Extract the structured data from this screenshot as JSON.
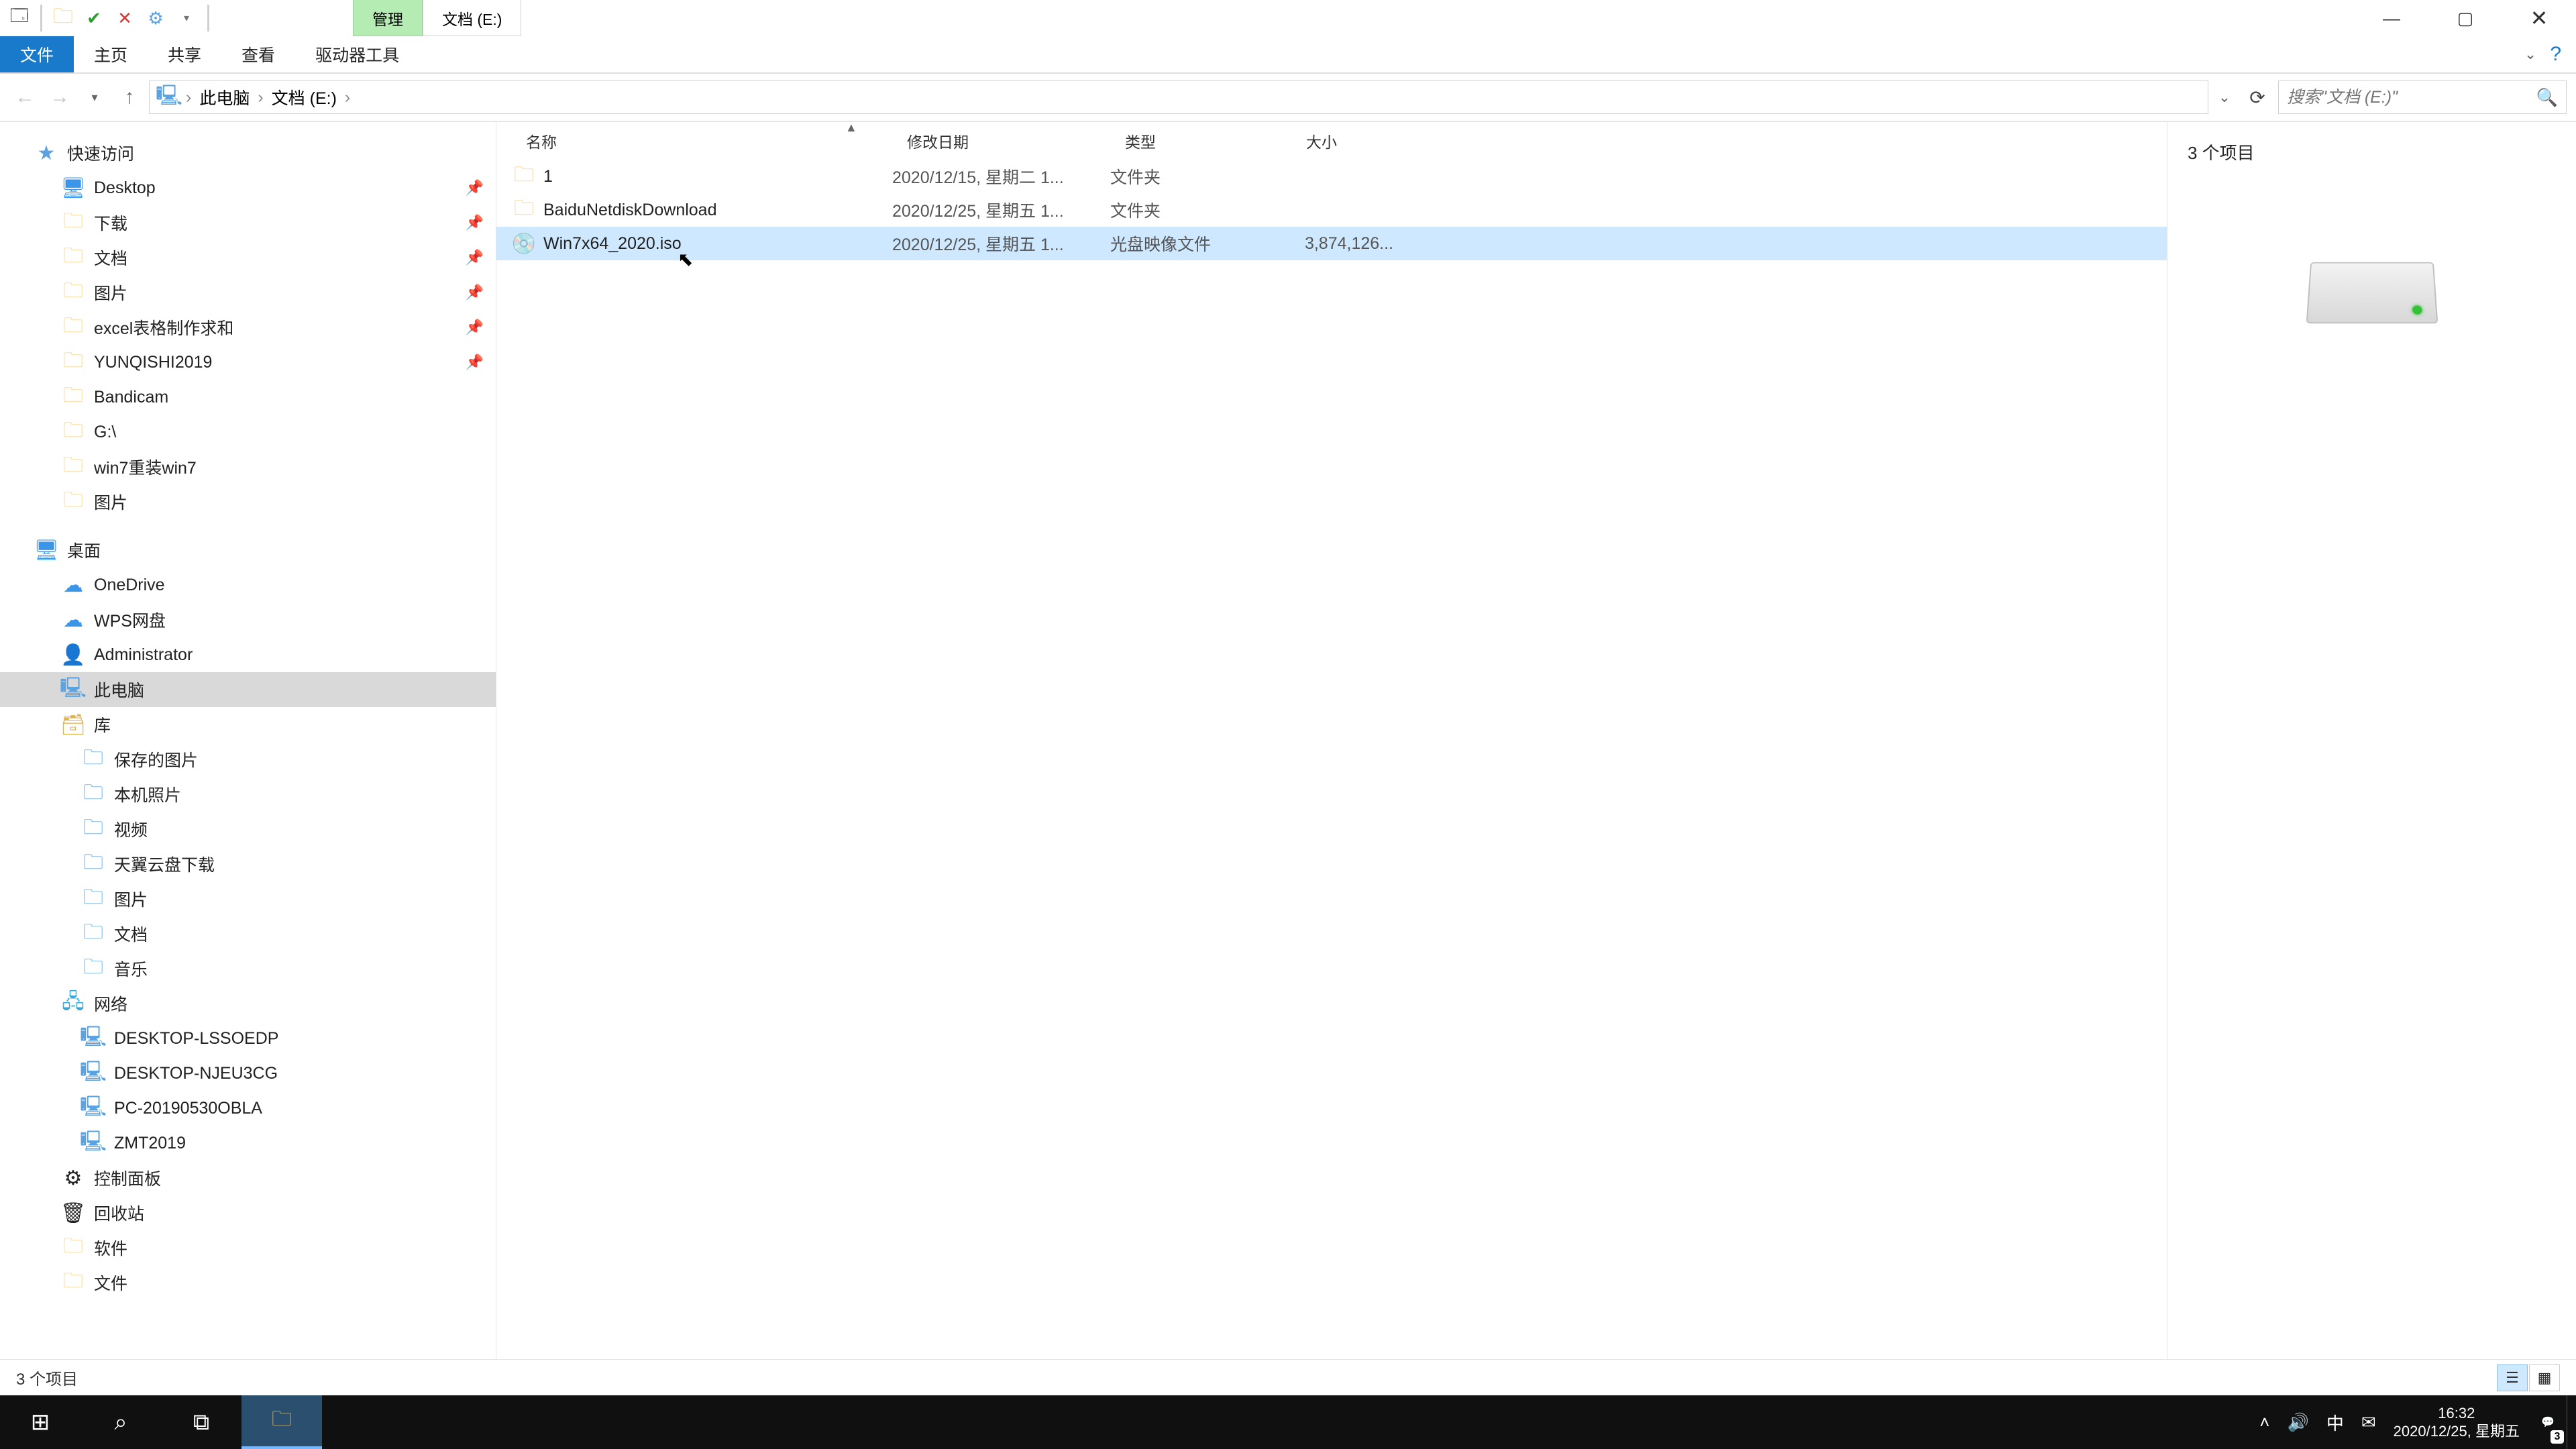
{
  "titlebar": {
    "contextual_tab": "管理",
    "title": "文档 (E:)",
    "qa_icons": [
      "app-icon",
      "open-folder-icon",
      "check-icon",
      "close-icon",
      "props-icon"
    ]
  },
  "ribbon": {
    "tabs": [
      {
        "label": "文件",
        "active": true
      },
      {
        "label": "主页",
        "active": false
      },
      {
        "label": "共享",
        "active": false
      },
      {
        "label": "查看",
        "active": false
      },
      {
        "label": "驱动器工具",
        "active": false
      }
    ]
  },
  "address": {
    "crumbs": [
      "此电脑",
      "文档 (E:)"
    ],
    "search_placeholder": "搜索\"文档 (E:)\""
  },
  "tree": [
    {
      "label": "快速访问",
      "icon": "star",
      "lvl": 0
    },
    {
      "label": "Desktop",
      "icon": "desktop",
      "lvl": 1,
      "pin": true
    },
    {
      "label": "下载",
      "icon": "folder",
      "lvl": 1,
      "pin": true
    },
    {
      "label": "文档",
      "icon": "folder",
      "lvl": 1,
      "pin": true
    },
    {
      "label": "图片",
      "icon": "folder",
      "lvl": 1,
      "pin": true
    },
    {
      "label": "excel表格制作求和",
      "icon": "folder",
      "lvl": 1,
      "pin": true
    },
    {
      "label": "YUNQISHI2019",
      "icon": "folder",
      "lvl": 1,
      "pin": true
    },
    {
      "label": "Bandicam",
      "icon": "folder",
      "lvl": 1
    },
    {
      "label": "G:\\",
      "icon": "folder",
      "lvl": 1
    },
    {
      "label": "win7重装win7",
      "icon": "folder",
      "lvl": 1
    },
    {
      "label": "图片",
      "icon": "folder",
      "lvl": 1
    },
    {
      "spacer": true
    },
    {
      "label": "桌面",
      "icon": "desktop",
      "lvl": 0
    },
    {
      "label": "OneDrive",
      "icon": "cloud",
      "lvl": 1
    },
    {
      "label": "WPS网盘",
      "icon": "cloud",
      "lvl": 1
    },
    {
      "label": "Administrator",
      "icon": "user",
      "lvl": 1
    },
    {
      "label": "此电脑",
      "icon": "pc",
      "lvl": 1,
      "selected": true
    },
    {
      "label": "库",
      "icon": "lib",
      "lvl": 1
    },
    {
      "label": "保存的图片",
      "icon": "box",
      "lvl": 2
    },
    {
      "label": "本机照片",
      "icon": "box",
      "lvl": 2
    },
    {
      "label": "视频",
      "icon": "box",
      "lvl": 2
    },
    {
      "label": "天翼云盘下载",
      "icon": "box",
      "lvl": 2
    },
    {
      "label": "图片",
      "icon": "box",
      "lvl": 2
    },
    {
      "label": "文档",
      "icon": "box",
      "lvl": 2
    },
    {
      "label": "音乐",
      "icon": "box",
      "lvl": 2
    },
    {
      "label": "网络",
      "icon": "net",
      "lvl": 1
    },
    {
      "label": "DESKTOP-LSSOEDP",
      "icon": "pc",
      "lvl": 2
    },
    {
      "label": "DESKTOP-NJEU3CG",
      "icon": "pc",
      "lvl": 2
    },
    {
      "label": "PC-20190530OBLA",
      "icon": "pc",
      "lvl": 2
    },
    {
      "label": "ZMT2019",
      "icon": "pc",
      "lvl": 2
    },
    {
      "label": "控制面板",
      "icon": "panel",
      "lvl": 1
    },
    {
      "label": "回收站",
      "icon": "bin",
      "lvl": 1
    },
    {
      "label": "软件",
      "icon": "folder",
      "lvl": 1
    },
    {
      "label": "文件",
      "icon": "folder",
      "lvl": 1
    }
  ],
  "columns": {
    "name": "名称",
    "date": "修改日期",
    "type": "类型",
    "size": "大小"
  },
  "files": [
    {
      "name": "1",
      "date": "2020/12/15, 星期二 1...",
      "type": "文件夹",
      "size": "",
      "icon": "folder"
    },
    {
      "name": "BaiduNetdiskDownload",
      "date": "2020/12/25, 星期五 1...",
      "type": "文件夹",
      "size": "",
      "icon": "folder"
    },
    {
      "name": "Win7x64_2020.iso",
      "date": "2020/12/25, 星期五 1...",
      "type": "光盘映像文件",
      "size": "3,874,126...",
      "icon": "iso",
      "selected": true
    }
  ],
  "preview": {
    "summary": "3 个项目"
  },
  "statusbar": {
    "text": "3 个项目"
  },
  "taskbar": {
    "buttons": [
      "start",
      "search",
      "taskview",
      "explorer"
    ],
    "tray": {
      "ime": "中",
      "time": "16:32",
      "date": "2020/12/25, 星期五",
      "notifications": "3"
    }
  }
}
